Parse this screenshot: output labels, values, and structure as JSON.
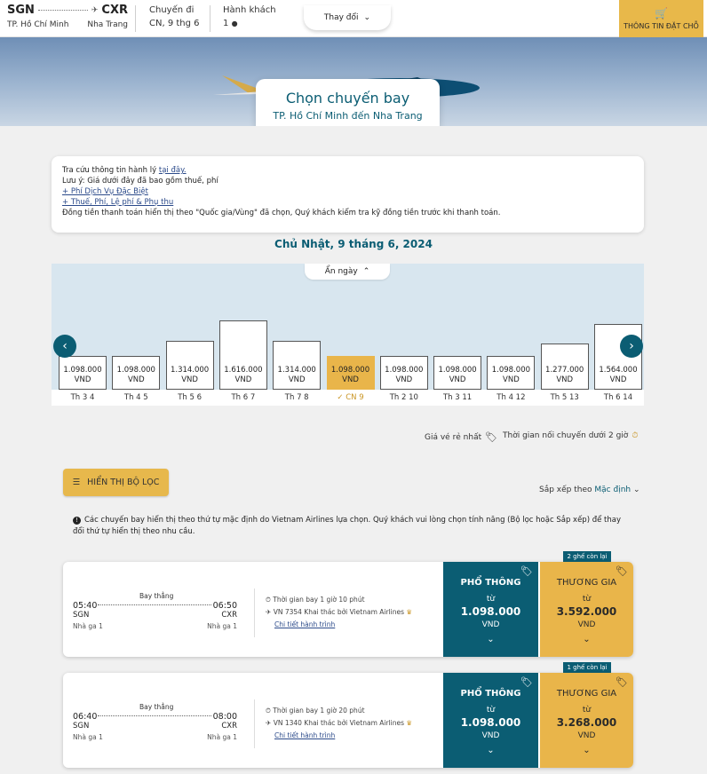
{
  "header": {
    "origin_code": "SGN",
    "dest_code": "CXR",
    "origin_city": "TP. Hồ Chí Minh",
    "dest_city": "Nha Trang",
    "trip_label": "Chuyến đi",
    "trip_date": "CN, 9 thg 6",
    "pax_label": "Hành khách",
    "pax_value": "1",
    "change_label": "Thay đổi",
    "booking_label": "THÔNG TIN ĐẶT CHỖ"
  },
  "hero": {
    "title": "Chọn chuyến bay",
    "subtitle": "TP. Hồ Chí Minh đến Nha Trang"
  },
  "info": {
    "line1_prefix": "Tra cứu thông tin hành lý",
    "line1_link": "tại đây.",
    "line2": "Lưu ý: Giá dưới đây đã bao gồm thuế, phí",
    "link_special": "+ Phí Dịch Vụ Đặc Biệt",
    "link_tax": "+ Thuế, Phí, Lệ phí & Phụ thu",
    "line5": "Đồng tiền thanh toán hiển thị theo \"Quốc gia/Vùng\" đã chọn, Quý khách kiểm tra kỹ đồng tiền trước khi thanh toán."
  },
  "date_title": "Chủ Nhật, 9 tháng 6, 2024",
  "calendar": {
    "hide_label": "Ẩn ngày",
    "days": [
      {
        "label": "Th 3 4",
        "price": "1.098.000",
        "currency": "VND",
        "active": false
      },
      {
        "label": "Th 4 5",
        "price": "1.098.000",
        "currency": "VND",
        "active": false
      },
      {
        "label": "Th 5 6",
        "price": "1.314.000",
        "currency": "VND",
        "active": false
      },
      {
        "label": "Th 6 7",
        "price": "1.616.000",
        "currency": "VND",
        "active": false
      },
      {
        "label": "Th 7 8",
        "price": "1.314.000",
        "currency": "VND",
        "active": false
      },
      {
        "label": "CN 9",
        "price": "1.098.000",
        "currency": "VND",
        "active": true
      },
      {
        "label": "Th 2 10",
        "price": "1.098.000",
        "currency": "VND",
        "active": false
      },
      {
        "label": "Th 3 11",
        "price": "1.098.000",
        "currency": "VND",
        "active": false
      },
      {
        "label": "Th 4 12",
        "price": "1.098.000",
        "currency": "VND",
        "active": false
      },
      {
        "label": "Th 5 13",
        "price": "1.277.000",
        "currency": "VND",
        "active": false
      },
      {
        "label": "Th 6 14",
        "price": "1.564.000",
        "currency": "VND",
        "active": false
      }
    ]
  },
  "legend": {
    "cheapest": "Giá vé rẻ nhất",
    "connection": "Thời gian nối chuyến dưới 2 giờ"
  },
  "filter_label": "HIỂN THỊ BỘ LỌC",
  "sort": {
    "label": "Sắp xếp theo",
    "value": "Mặc định"
  },
  "notice": "Các chuyến bay hiển thị theo thứ tự mặc định do Vietnam Airlines lựa chọn. Quý khách vui lòng chọn tính năng (Bộ lọc hoặc Sắp xếp) để thay đổi thứ tự hiển thị theo nhu cầu.",
  "flights": [
    {
      "seats_left": "2 ghế còn lại",
      "dep_time": "05:40",
      "arr_time": "06:50",
      "dep_code": "SGN",
      "arr_code": "CXR",
      "dep_terminal": "Nhà ga 1",
      "arr_terminal": "Nhà ga 1",
      "type": "Bay thẳng",
      "duration": "Thời gian bay 1 giờ 10 phút",
      "operator": "VN 7354 Khai thác bởi Vietnam Airlines",
      "details_link": "Chi tiết hành trình",
      "eco_class": "PHỔ THÔNG",
      "eco_from": "từ",
      "eco_price": "1.098.000",
      "eco_cur": "VND",
      "bus_class": "THƯƠNG GIA",
      "bus_from": "từ",
      "bus_price": "3.592.000",
      "bus_cur": "VND"
    },
    {
      "seats_left": "1 ghế còn lại",
      "dep_time": "06:40",
      "arr_time": "08:00",
      "dep_code": "SGN",
      "arr_code": "CXR",
      "dep_terminal": "Nhà ga 1",
      "arr_terminal": "Nhà ga 1",
      "type": "Bay thẳng",
      "duration": "Thời gian bay 1 giờ 20 phút",
      "operator": "VN 1340 Khai thác bởi Vietnam Airlines",
      "details_link": "Chi tiết hành trình",
      "eco_class": "PHỔ THÔNG",
      "eco_from": "từ",
      "eco_price": "1.098.000",
      "eco_cur": "VND",
      "bus_class": "THƯƠNG GIA",
      "bus_from": "từ",
      "bus_price": "3.268.000",
      "bus_cur": "VND"
    }
  ],
  "colors": {
    "brand": "#0b5d73",
    "accent": "#e9b54a"
  }
}
